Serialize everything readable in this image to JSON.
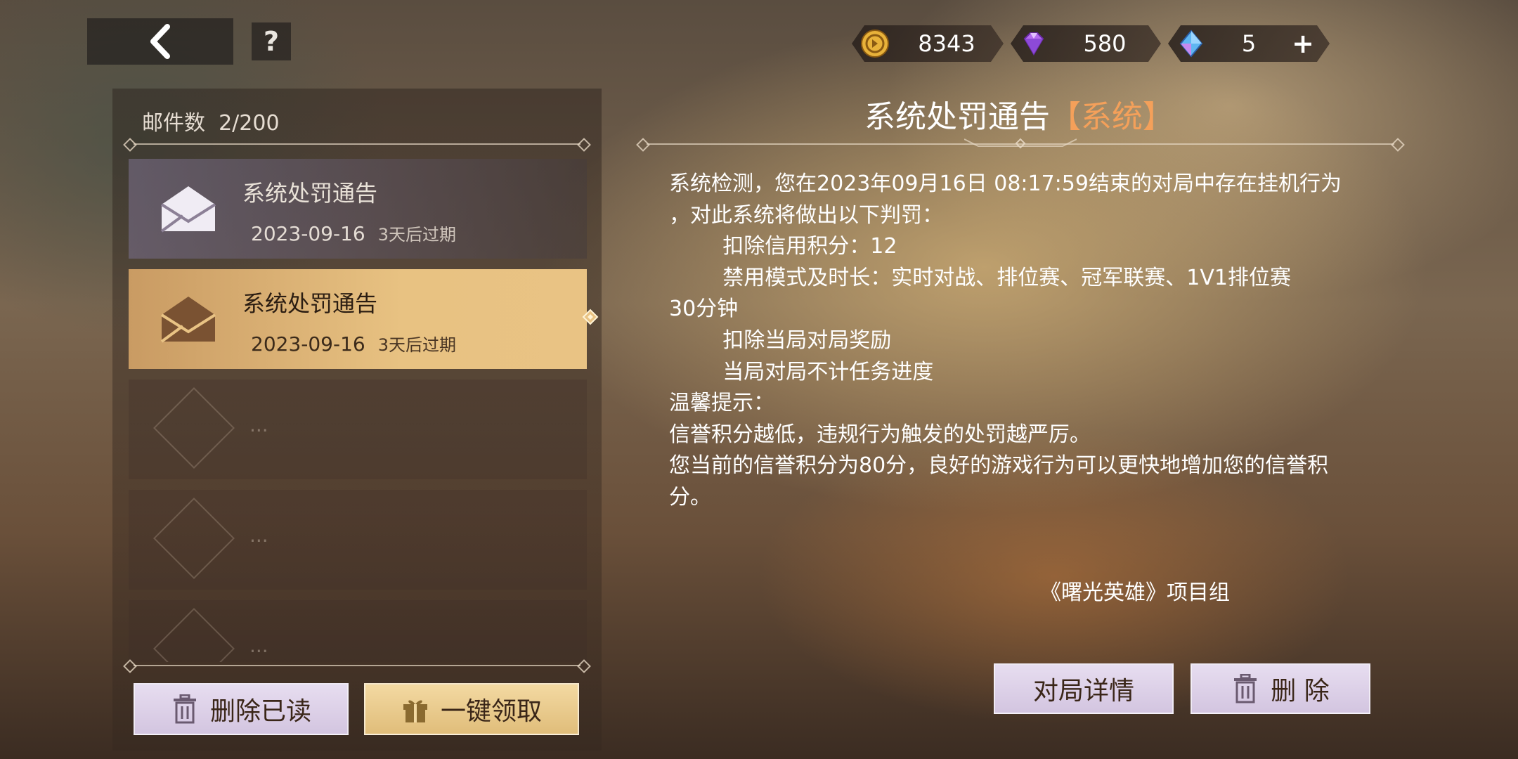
{
  "header": {
    "help_label": "?",
    "currencies": [
      {
        "icon": "gold-coin-icon",
        "value": "8343"
      },
      {
        "icon": "purple-gem-icon",
        "value": "580"
      },
      {
        "icon": "blue-crystal-icon",
        "value": "5",
        "add_label": "+"
      }
    ]
  },
  "mailbox": {
    "count_label": "邮件数",
    "count_value": "2/200",
    "items": [
      {
        "subject": "系统处罚通告",
        "date": "2023-09-16",
        "expire": "3天后过期",
        "state": "read"
      },
      {
        "subject": "系统处罚通告",
        "date": "2023-09-16",
        "expire": "3天后过期",
        "state": "selected"
      }
    ],
    "empty_placeholder": "...",
    "delete_read_label": "删除已读",
    "claim_all_label": "一键领取"
  },
  "detail": {
    "title": "系统处罚通告",
    "tag": "【系统】",
    "lines": [
      "系统检测，您在2023年09月16日 08:17:59结束的对局中存在挂机行为",
      "，对此系统将做出以下判罚：",
      "        扣除信用积分：12",
      "        禁用模式及时长：实时对战、排位赛、冠军联赛、1V1排位赛",
      "30分钟",
      "        扣除当局对局奖励",
      "        当局对局不计任务进度",
      "温馨提示：",
      "信誉积分越低，违规行为触发的处罚越严厉。",
      "您当前的信誉积分为80分，良好的游戏行为可以更快地增加您的信誉积",
      "分。"
    ],
    "signature": "《曙光英雄》项目组",
    "match_detail_label": "对局详情",
    "delete_label": "删 除"
  },
  "colors": {
    "accent_tag": "#f4a05a",
    "selected_item": "#e8c282",
    "button_purple": "#e7ddf0",
    "button_gold": "#f3d9a2"
  }
}
